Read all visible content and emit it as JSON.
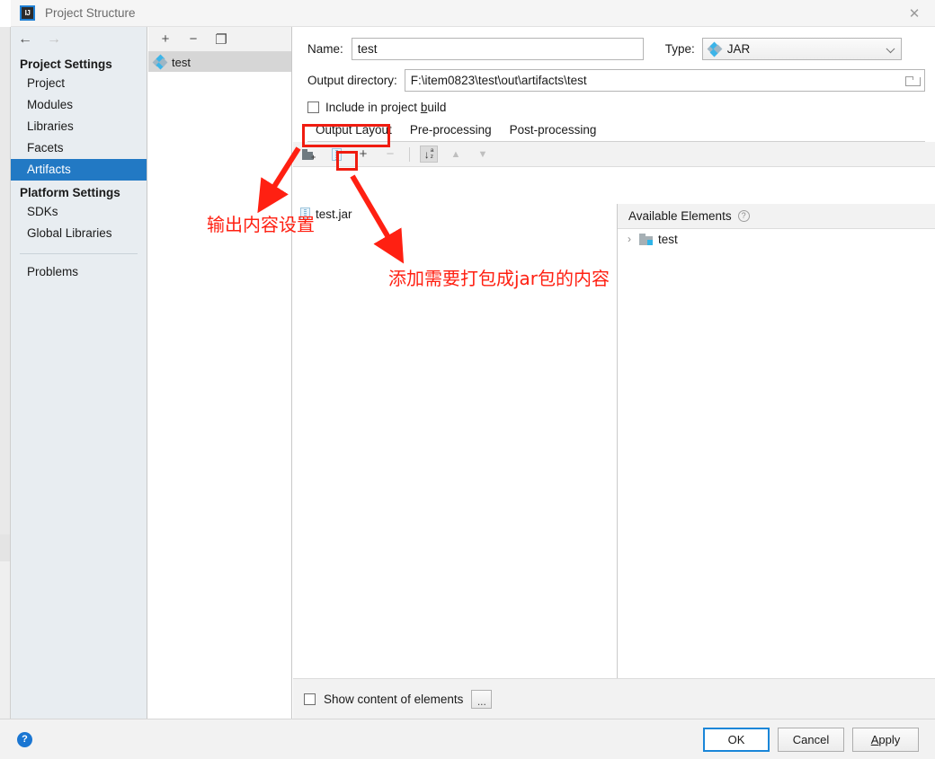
{
  "window": {
    "title": "Project Structure",
    "logo_text": "IJ",
    "close_label": "✕"
  },
  "sidebar": {
    "nav": {
      "back": "←",
      "forward": "→"
    },
    "groups": [
      {
        "label": "Project Settings",
        "items": [
          {
            "label": "Project",
            "selected": false
          },
          {
            "label": "Modules",
            "selected": false
          },
          {
            "label": "Libraries",
            "selected": false
          },
          {
            "label": "Facets",
            "selected": false
          },
          {
            "label": "Artifacts",
            "selected": true
          }
        ]
      },
      {
        "label": "Platform Settings",
        "items": [
          {
            "label": "SDKs",
            "selected": false
          },
          {
            "label": "Global Libraries",
            "selected": false
          }
        ]
      }
    ],
    "problems_label": "Problems"
  },
  "artifacts_panel": {
    "toolbar": [
      {
        "name": "add-artifact-button",
        "glyph": "+"
      },
      {
        "name": "remove-artifact-button",
        "glyph": "−"
      },
      {
        "name": "copy-artifact-button",
        "glyph": "❐"
      }
    ],
    "items": [
      {
        "label": "test",
        "selected": true,
        "icon": "jar-diamond-icon"
      }
    ]
  },
  "form": {
    "name_label": "Name:",
    "name_value": "test",
    "type_label": "Type:",
    "type_value": "JAR",
    "output_dir_label": "Output directory:",
    "output_dir_value": "F:\\item0823\\test\\out\\artifacts\\test",
    "include_in_build_label": "Include in project build",
    "include_in_build_checked": false
  },
  "tabs": [
    {
      "label": "Output Layout",
      "active": true
    },
    {
      "label": "Pre-processing",
      "active": false
    },
    {
      "label": "Post-processing",
      "active": false
    }
  ],
  "layout_toolbar": [
    {
      "name": "create-directory-button",
      "glyph": ""
    },
    {
      "name": "create-archive-button",
      "glyph": ""
    },
    {
      "name": "add-copy-button",
      "glyph": "+"
    },
    {
      "name": "remove-button",
      "glyph": "−"
    },
    {
      "name": "sort-by-name-button",
      "glyph": ""
    },
    {
      "name": "move-up-button",
      "glyph": "▲"
    },
    {
      "name": "move-down-button",
      "glyph": "▼"
    }
  ],
  "output_tree": [
    {
      "label": "test.jar",
      "icon": "archive-icon"
    }
  ],
  "available_elements": {
    "header": "Available Elements",
    "help_glyph": "?",
    "items": [
      {
        "label": "test",
        "expand_glyph": "›",
        "icon": "module-folder-icon"
      }
    ]
  },
  "content_bottom": {
    "show_content_label": "Show content of elements",
    "show_content_checked": false,
    "more_button_label": "..."
  },
  "footer": {
    "help_glyph": "?",
    "buttons": [
      {
        "label": "OK",
        "default": true
      },
      {
        "label": "Cancel",
        "default": false
      },
      {
        "label": "Apply",
        "default": false
      }
    ]
  },
  "annotations": [
    {
      "name": "annotation-output-layout-note",
      "text": "输出内容设置"
    },
    {
      "name": "annotation-add-jar-content-note",
      "text": "添加需要打包成jar包的内容"
    }
  ],
  "colors": {
    "accent_blue": "#2279c4",
    "annotation_red": "#ff2012",
    "sidebar_bg": "#e8edf1",
    "toolbar_bg": "#f2f2f2"
  }
}
